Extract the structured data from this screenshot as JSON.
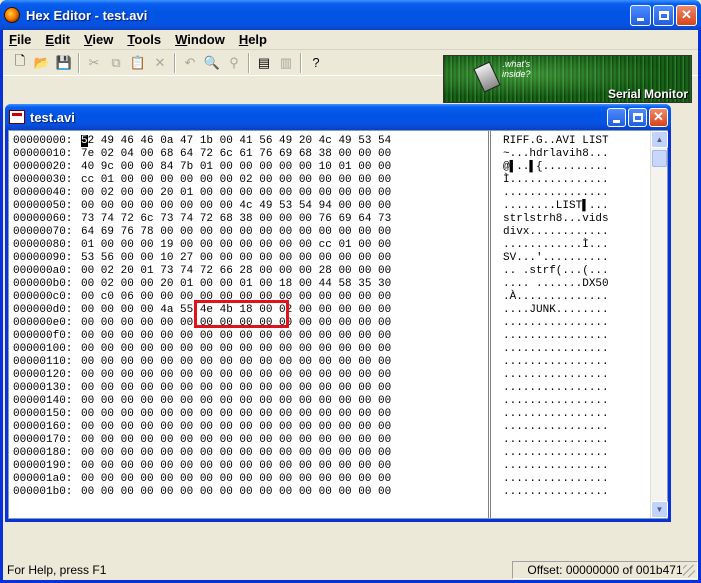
{
  "app": {
    "title": "Hex Editor - test.avi"
  },
  "menu": [
    {
      "accel": "F",
      "rest": "ile"
    },
    {
      "accel": "E",
      "rest": "dit"
    },
    {
      "accel": "V",
      "rest": "iew"
    },
    {
      "accel": "T",
      "rest": "ools"
    },
    {
      "accel": "W",
      "rest": "indow"
    },
    {
      "accel": "H",
      "rest": "elp"
    }
  ],
  "toolbar": {
    "buttons": [
      {
        "name": "new-icon",
        "glyph": "🗋",
        "enabled": true
      },
      {
        "name": "open-icon",
        "glyph": "📂",
        "enabled": true
      },
      {
        "name": "save-icon",
        "glyph": "💾",
        "enabled": true
      },
      {
        "sep": true
      },
      {
        "name": "cut-icon",
        "glyph": "✂",
        "enabled": false
      },
      {
        "name": "copy-icon",
        "glyph": "⧉",
        "enabled": false
      },
      {
        "name": "paste-icon",
        "glyph": "📋",
        "enabled": false
      },
      {
        "name": "delete-icon",
        "glyph": "✕",
        "enabled": false
      },
      {
        "sep": true
      },
      {
        "name": "undo-icon",
        "glyph": "↶",
        "enabled": false
      },
      {
        "name": "find-icon",
        "glyph": "🔍",
        "enabled": true
      },
      {
        "name": "replace-icon",
        "glyph": "⚲",
        "enabled": false
      },
      {
        "sep": true
      },
      {
        "name": "compare-icon",
        "glyph": "▤",
        "enabled": true
      },
      {
        "name": "print-icon",
        "glyph": "▥",
        "enabled": false
      },
      {
        "sep": true
      },
      {
        "name": "help-icon",
        "glyph": "?",
        "enabled": true
      }
    ]
  },
  "banner": {
    "question": ".what's\ninside?",
    "title": "Serial Monitor"
  },
  "document": {
    "title": "test.avi",
    "rows": [
      {
        "offset": "00000000:",
        "hex": "52 49 46 46 0a 47 1b 00 41 56 49 20 4c 49 53 54",
        "ascii": "RIFF.G..AVI LIST"
      },
      {
        "offset": "00000010:",
        "hex": "7e 02 04 00 68 64 72 6c 61 76 69 68 38 00 00 00",
        "ascii": "~...hdrlavih8..."
      },
      {
        "offset": "00000020:",
        "hex": "40 9c 00 00 84 7b 01 00 00 00 00 00 10 01 00 00",
        "ascii": "@▌..▌{.........."
      },
      {
        "offset": "00000030:",
        "hex": "cc 01 00 00 00 00 00 00 02 00 00 00 00 00 00 00",
        "ascii": "Ì..............."
      },
      {
        "offset": "00000040:",
        "hex": "00 02 00 00 20 01 00 00 00 00 00 00 00 00 00 00",
        "ascii": "................"
      },
      {
        "offset": "00000050:",
        "hex": "00 00 00 00 00 00 00 00 4c 49 53 54 94 00 00 00",
        "ascii": "........LIST▌..."
      },
      {
        "offset": "00000060:",
        "hex": "73 74 72 6c 73 74 72 68 38 00 00 00 76 69 64 73",
        "ascii": "strlstrh8...vids"
      },
      {
        "offset": "00000070:",
        "hex": "64 69 76 78 00 00 00 00 00 00 00 00 00 00 00 00",
        "ascii": "divx............"
      },
      {
        "offset": "00000080:",
        "hex": "01 00 00 00 19 00 00 00 00 00 00 00 cc 01 00 00",
        "ascii": "............Ì..."
      },
      {
        "offset": "00000090:",
        "hex": "53 56 00 00 10 27 00 00 00 00 00 00 00 00 00 00",
        "ascii": "SV...'.........."
      },
      {
        "offset": "000000a0:",
        "hex": "00 02 20 01 73 74 72 66 28 00 00 00 28 00 00 00",
        "ascii": ".. .strf(...(..."
      },
      {
        "offset": "000000b0:",
        "hex": "00 02 00 00 20 01 00 00 01 00 18 00 44 58 35 30",
        "ascii": ".... .......DX50"
      },
      {
        "offset": "000000c0:",
        "hex": "00 c0 06 00 00 00 00 00 00 00 00 00 00 00 00 00",
        "ascii": ".À.............."
      },
      {
        "offset": "000000d0:",
        "hex": "00 00 00 00 4a 55 4e 4b 18 00 02 00 00 00 00 00",
        "ascii": "....JUNK........"
      },
      {
        "offset": "000000e0:",
        "hex": "00 00 00 00 00 00 00 00 00 00 00 00 00 00 00 00",
        "ascii": "................"
      },
      {
        "offset": "000000f0:",
        "hex": "00 00 00 00 00 00 00 00 00 00 00 00 00 00 00 00",
        "ascii": "................"
      },
      {
        "offset": "00000100:",
        "hex": "00 00 00 00 00 00 00 00 00 00 00 00 00 00 00 00",
        "ascii": "................"
      },
      {
        "offset": "00000110:",
        "hex": "00 00 00 00 00 00 00 00 00 00 00 00 00 00 00 00",
        "ascii": "................"
      },
      {
        "offset": "00000120:",
        "hex": "00 00 00 00 00 00 00 00 00 00 00 00 00 00 00 00",
        "ascii": "................"
      },
      {
        "offset": "00000130:",
        "hex": "00 00 00 00 00 00 00 00 00 00 00 00 00 00 00 00",
        "ascii": "................"
      },
      {
        "offset": "00000140:",
        "hex": "00 00 00 00 00 00 00 00 00 00 00 00 00 00 00 00",
        "ascii": "................"
      },
      {
        "offset": "00000150:",
        "hex": "00 00 00 00 00 00 00 00 00 00 00 00 00 00 00 00",
        "ascii": "................"
      },
      {
        "offset": "00000160:",
        "hex": "00 00 00 00 00 00 00 00 00 00 00 00 00 00 00 00",
        "ascii": "................"
      },
      {
        "offset": "00000170:",
        "hex": "00 00 00 00 00 00 00 00 00 00 00 00 00 00 00 00",
        "ascii": "................"
      },
      {
        "offset": "00000180:",
        "hex": "00 00 00 00 00 00 00 00 00 00 00 00 00 00 00 00",
        "ascii": "................"
      },
      {
        "offset": "00000190:",
        "hex": "00 00 00 00 00 00 00 00 00 00 00 00 00 00 00 00",
        "ascii": "................"
      },
      {
        "offset": "000001a0:",
        "hex": "00 00 00 00 00 00 00 00 00 00 00 00 00 00 00 00",
        "ascii": "................"
      },
      {
        "offset": "000001b0:",
        "hex": "00 00 00 00 00 00 00 00 00 00 00 00 00 00 00 00",
        "ascii": "................"
      }
    ]
  },
  "status": {
    "help": "For Help, press F1",
    "offset": "Offset: 00000000 of 001b471"
  },
  "colors": {
    "title_blue": "#0055E5",
    "highlight_red": "#E0131A"
  }
}
